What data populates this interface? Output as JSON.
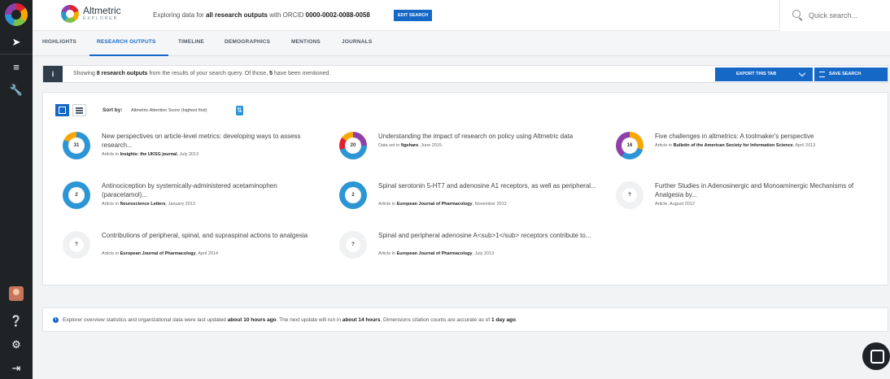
{
  "rail": {
    "icons": [
      "altmetric-logo-icon",
      "compass-icon",
      "list-icon",
      "wrench-icon",
      "avatar",
      "help-icon",
      "gear-icon",
      "logout-icon"
    ]
  },
  "header": {
    "brand_name": "Altmetric",
    "brand_sub": "EXPLORER",
    "query_prefix": "Exploring data for ",
    "query_scope": "all research outputs",
    "query_middle": " with ORCID ",
    "query_orcid": "0000-0002-0088-0058",
    "edit_search_label": "EDIT SEARCH",
    "search_placeholder": "Quick search..."
  },
  "tabs": [
    "HIGHLIGHTS",
    "RESEARCH OUTPUTS",
    "TIMELINE",
    "DEMOGRAPHICS",
    "MENTIONS",
    "JOURNALS"
  ],
  "active_tab": "RESEARCH OUTPUTS",
  "infobar": {
    "icon": "i",
    "text_1": "Showing ",
    "count": "8 research outputs",
    "text_2": " from the results of your search query. Of those, ",
    "mentioned": "5",
    "text_3": " have been mentioned.",
    "export_label": "EXPORT THIS TAB",
    "save_label": "SAVE SEARCH"
  },
  "sort": {
    "label": "Sort by:",
    "value": "Altmetric Attention Score (highest first)"
  },
  "outputs": [
    {
      "score": "31",
      "title": "New perspectives on article-level metrics: developing ways to assess research...",
      "type": "Article in ",
      "venue": "Insights: the UKSG journal",
      "date": ", July 2013"
    },
    {
      "score": "20",
      "title": "Understanding the impact of research on policy using Altmetric data",
      "type": "Data set in ",
      "venue": "figshare",
      "date": ", June 2015"
    },
    {
      "score": "16",
      "title": "Five challenges in altmetrics: A toolmaker's perspective",
      "type": "Article in ",
      "venue": "Bulletin of the American Society for Information Science",
      "date": ", April 2013"
    },
    {
      "score": "2",
      "title": "Antinociception by systemically-administered acetaminophen (paracetamol)...",
      "type": "Article in ",
      "venue": "Neuroscience Letters",
      "date": ", January 2013"
    },
    {
      "score": "2",
      "title": "Spinal serotonin 5-HT7 and adenosine A1 receptors, as well as peripheral...",
      "type": "Article in ",
      "venue": "European Journal of Pharmacology",
      "date": ", November 2012"
    },
    {
      "score": "?",
      "title": "Further Studies in Adenosinergic and Monoaminergic Mechanisms of Analgesia by...",
      "type": "Article, August 2012",
      "venue": "",
      "date": ""
    },
    {
      "score": "?",
      "title": "Contributions of peripheral, spinal, and supraspinal actions to analgesia",
      "type": "Article in ",
      "venue": "European Journal of Pharmacology",
      "date": ", April 2014"
    },
    {
      "score": "?",
      "title": "Spinal and peripheral adenosine A<sub>1</sub> receptors contribute to...",
      "type": "Article in ",
      "venue": "European Journal of Pharmacology",
      "date": ", July 2013"
    }
  ],
  "footer": {
    "t1": "Explorer overview statistics and organizational data were last updated ",
    "b1": "about 10 hours ago",
    "t2": ". The next update will run in ",
    "b2": "about 14 hours",
    "t3": ". Dimensions citation counts are accurate as of ",
    "b3": "1 day ago",
    "t4": "."
  }
}
